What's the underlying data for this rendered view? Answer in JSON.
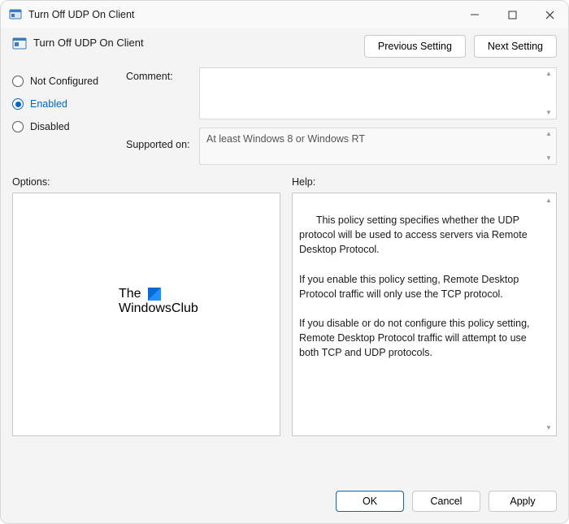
{
  "window": {
    "title": "Turn Off UDP On Client"
  },
  "header": {
    "policy_title": "Turn Off UDP On Client",
    "prev_btn": "Previous Setting",
    "next_btn": "Next Setting"
  },
  "radios": {
    "not_configured": "Not Configured",
    "enabled": "Enabled",
    "disabled": "Disabled",
    "selected": "enabled"
  },
  "labels": {
    "comment": "Comment:",
    "supported": "Supported on:",
    "options": "Options:",
    "help": "Help:"
  },
  "fields": {
    "comment_value": "",
    "supported_value": "At least Windows 8 or Windows RT"
  },
  "help_text": "This policy setting specifies whether the UDP protocol will be used to access servers via Remote Desktop Protocol.\n\nIf you enable this policy setting, Remote Desktop Protocol traffic will only use the TCP protocol.\n\nIf you disable or do not configure this policy setting, Remote Desktop Protocol traffic will attempt to use both TCP and UDP protocols.",
  "watermark": {
    "line1": "The",
    "line2": "WindowsClub"
  },
  "footer": {
    "ok": "OK",
    "cancel": "Cancel",
    "apply": "Apply"
  }
}
